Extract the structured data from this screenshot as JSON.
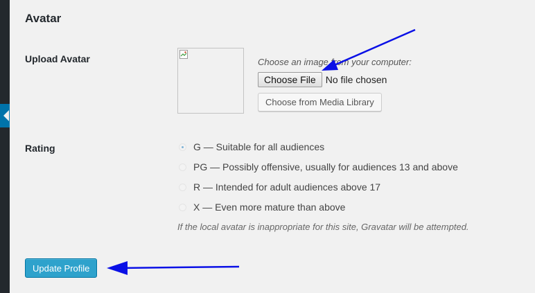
{
  "section": {
    "title": "Avatar"
  },
  "upload": {
    "label": "Upload Avatar",
    "hint": "Choose an image from your computer:",
    "choose_file_label": "Choose File",
    "file_status": "No file chosen",
    "media_library_label": "Choose from Media Library"
  },
  "rating": {
    "label": "Rating",
    "options": [
      {
        "text": "G — Suitable for all audiences",
        "checked": true
      },
      {
        "text": "PG — Possibly offensive, usually for audiences 13 and above",
        "checked": false
      },
      {
        "text": "R — Intended for adult audiences above 17",
        "checked": false
      },
      {
        "text": "X — Even more mature than above",
        "checked": false
      }
    ],
    "note": "If the local avatar is inappropriate for this site, Gravatar will be attempted."
  },
  "actions": {
    "update_label": "Update Profile"
  },
  "colors": {
    "admin_menu": "#23282d",
    "menu_active": "#0073aa",
    "primary_button": "#2ea2cc",
    "annotation_arrow": "#0a10e6"
  }
}
